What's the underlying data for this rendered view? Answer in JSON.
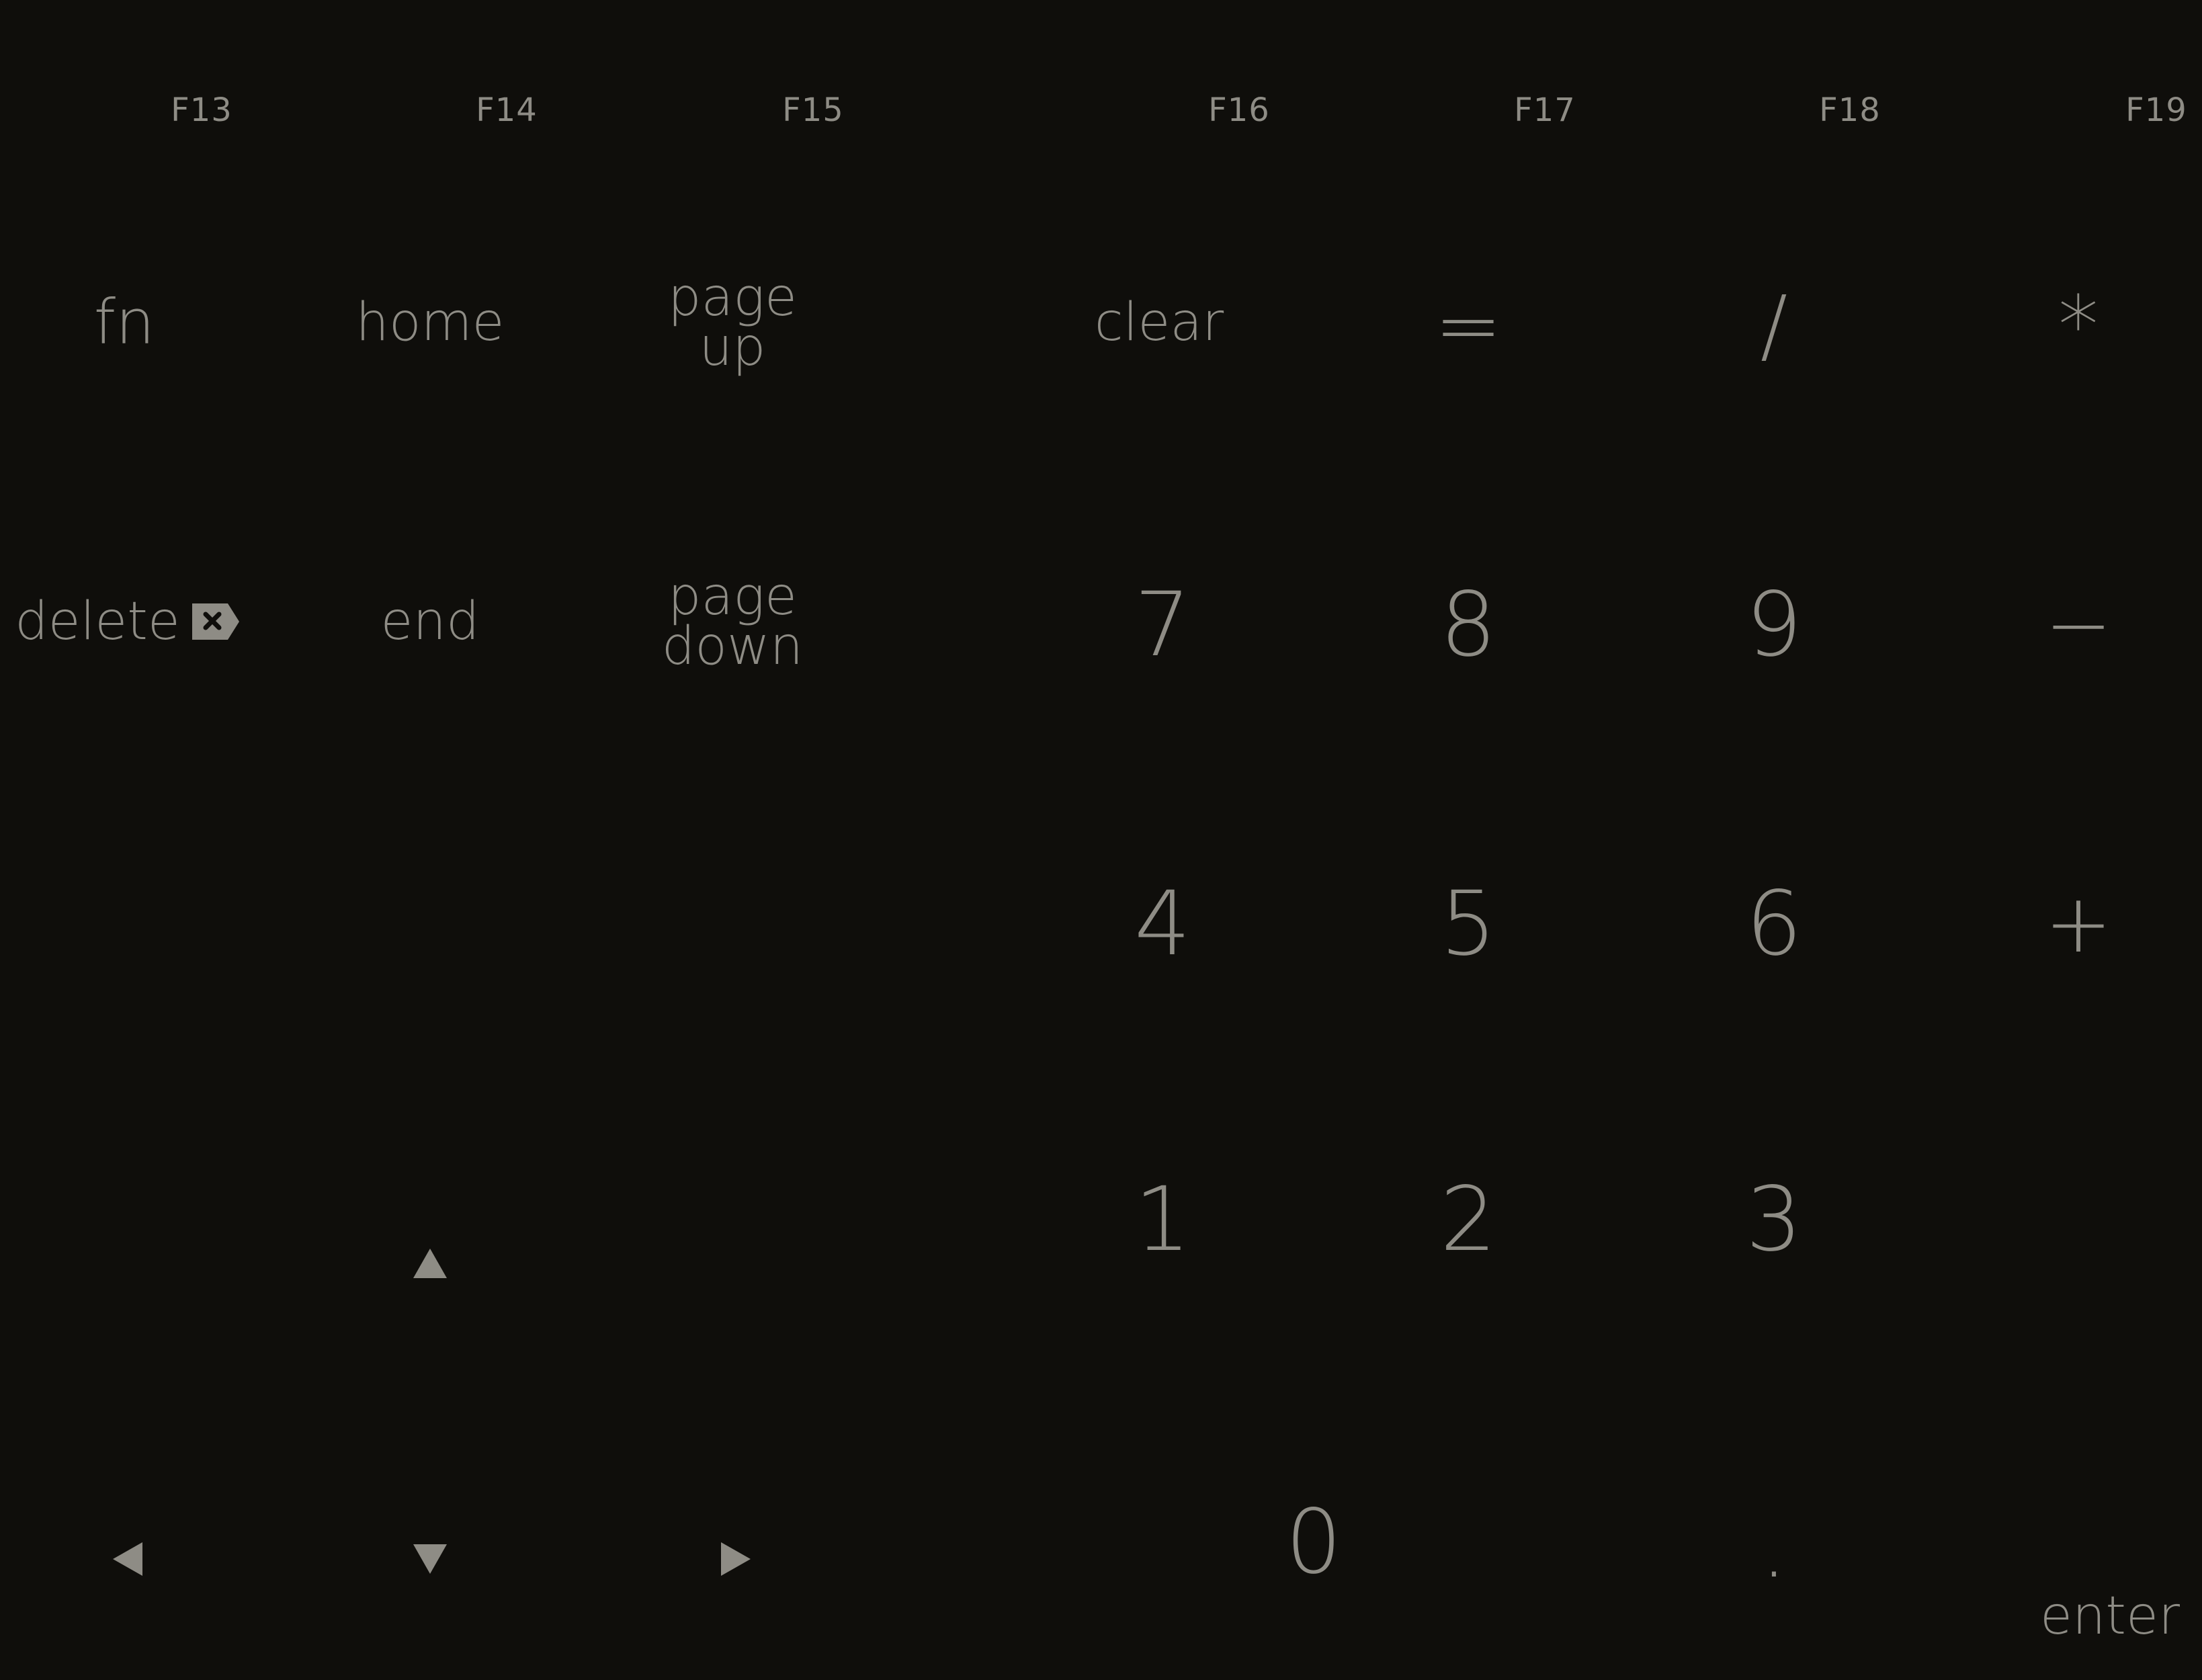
{
  "function_row": [
    {
      "label": "F13"
    },
    {
      "label": "F14"
    },
    {
      "label": "F15"
    },
    {
      "label": "F16"
    },
    {
      "label": "F17"
    },
    {
      "label": "F18"
    },
    {
      "label": "F19"
    }
  ],
  "keys": {
    "fn": "fn",
    "home": "home",
    "page_up_line1": "page",
    "page_up_line2": "up",
    "clear": "clear",
    "equals": "=",
    "divide": "/",
    "multiply": "*",
    "delete": "delete",
    "end": "end",
    "page_down_line1": "page",
    "page_down_line2": "down",
    "seven": "7",
    "eight": "8",
    "nine": "9",
    "minus": "−",
    "four": "4",
    "five": "5",
    "six": "6",
    "plus": "+",
    "one": "1",
    "two": "2",
    "three": "3",
    "zero": "0",
    "decimal": ".",
    "enter": "enter"
  },
  "icons": {
    "delete": "delete-forward-icon",
    "up": "arrow-up-icon",
    "left": "arrow-left-icon",
    "down": "arrow-down-icon",
    "right": "arrow-right-icon"
  },
  "colors": {
    "background": "#0f0e0b",
    "text": "#8e8c85"
  }
}
